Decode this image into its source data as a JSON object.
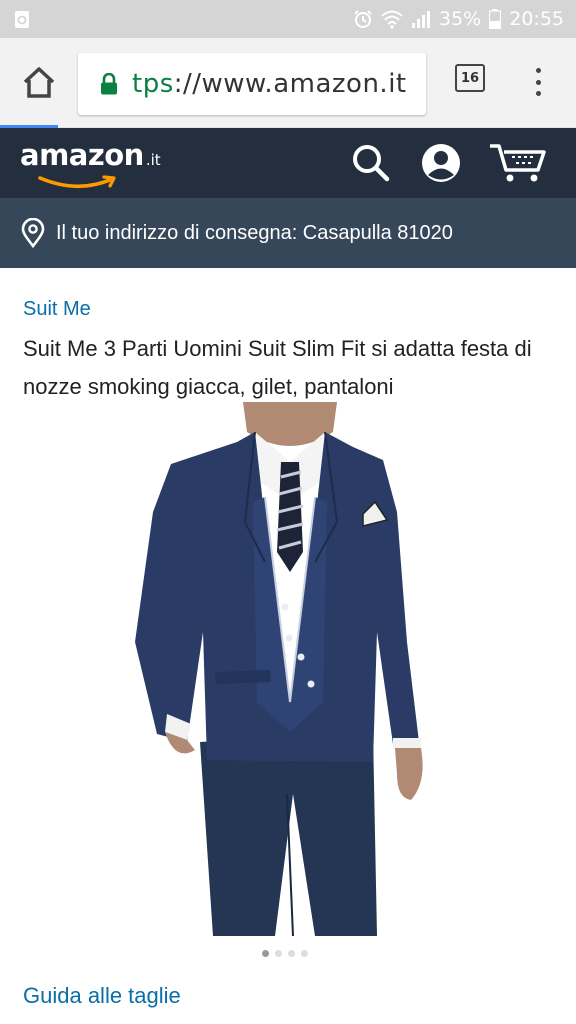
{
  "status_bar": {
    "battery": "35%",
    "time": "20:55",
    "icons": [
      "clipboard-icon",
      "alarm-icon",
      "wifi-icon",
      "signal-icon",
      "battery-icon"
    ]
  },
  "browser": {
    "url_scheme_part": "tps",
    "url_rest": "://www.amazon.it",
    "tab_count": "16",
    "load_progress": 0.1,
    "icons": [
      "home-icon",
      "lock-icon",
      "overflow-menu-icon"
    ]
  },
  "amazon_header": {
    "logo_word": "amazon",
    "logo_tld": ".it",
    "icons": [
      "search-icon",
      "account-icon",
      "cart-icon"
    ],
    "colors": {
      "header_bg": "#232f3e",
      "accent": "#ff9900"
    }
  },
  "delivery": {
    "text": "Il tuo indirizzo di consegna: Casapulla 81020",
    "icon": "location-pin-icon",
    "bg": "#37475a"
  },
  "product": {
    "brand": "Suit Me",
    "title": "Suit Me 3 Parti Uomini Suit Slim Fit si adatta festa di nozze smoking giacca, gilet, pantaloni",
    "image_count": 4,
    "active_image": 1,
    "size_guide": "Guida alle taglie"
  }
}
